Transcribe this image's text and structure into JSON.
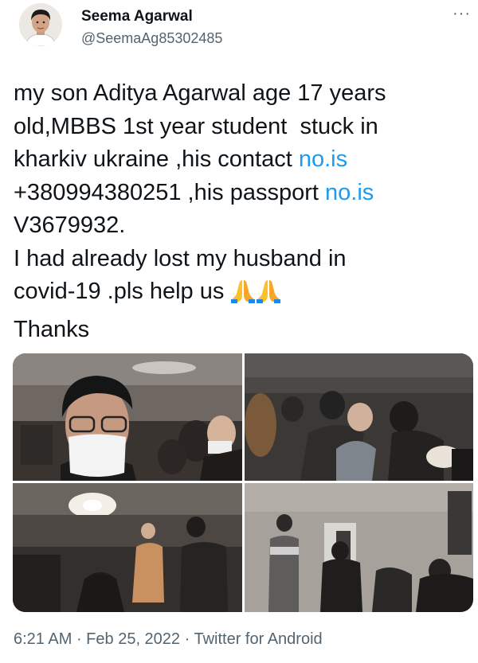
{
  "author": {
    "display_name": "Seema Agarwal",
    "handle": "@SeemaAg85302485"
  },
  "more_label": "···",
  "tweet": {
    "seg1": "my son Aditya Agarwal age 17 years\nold,MBBS 1st year student  stuck in\nkharkiv ukraine ,his contact ",
    "link1": "no.is",
    "seg2": "\n+380994380251 ,his passport ",
    "link2": "no.is",
    "seg3": "\nV3679932.\nI had already lost my husband in\ncovid-19 .pls help us ",
    "seg4": "\nThanks"
  },
  "emoji": [
    "folded-hands-icon",
    "folded-hands-icon"
  ],
  "meta": {
    "time": "6:21 AM",
    "sep1": " · ",
    "date": "Feb 25, 2022",
    "sep2": " · ",
    "source": "Twitter for Android"
  },
  "colors": {
    "link": "#1d9bf0",
    "secondary_text": "#536471",
    "primary_text": "#0f1419"
  }
}
